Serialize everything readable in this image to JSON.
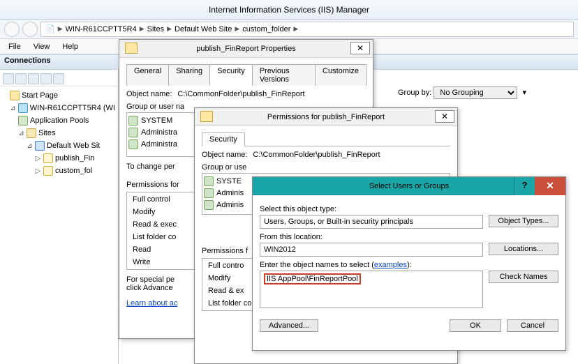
{
  "window": {
    "title": "Internet Information Services (IIS) Manager"
  },
  "breadcrumb": [
    "WIN-R61CCPTT5R4",
    "Sites",
    "Default Web Site",
    "custom_folder"
  ],
  "menu": {
    "file": "File",
    "view": "View",
    "help": "Help"
  },
  "connections": {
    "header": "Connections"
  },
  "tree": {
    "start": "Start Page",
    "server": "WIN-R61CCPTT5R4 (WI",
    "pools": "Application Pools",
    "sites": "Sites",
    "defaultSite": "Default Web Sit",
    "pub": "publish_Fin",
    "custom": "custom_fol"
  },
  "groupby": {
    "label": "Group by:",
    "value": "No Grouping"
  },
  "props": {
    "title": "publish_FinReport Properties",
    "tabs": {
      "general": "General",
      "sharing": "Sharing",
      "security": "Security",
      "prev": "Previous Versions",
      "custom": "Customize"
    },
    "objNameLabel": "Object name:",
    "objName": "C:\\CommonFolder\\publish_FinReport",
    "groupLabel": "Group or user na",
    "system": "SYSTEM",
    "admin1": "Administra",
    "admin2": "Administra",
    "changeLine": "To change per",
    "permFor": "Permissions for",
    "fullControl": "Full control",
    "modify": "Modify",
    "readExec": "Read & exec",
    "listFolder": "List folder co",
    "read": "Read",
    "write": "Write",
    "special": "For special pe",
    "advancedClick": "click Advance",
    "learn": "Learn about ac"
  },
  "perm": {
    "title": "Permissions for publish_FinReport",
    "tab": "Security",
    "objNameLabel": "Object name:",
    "objName": "C:\\CommonFolder\\publish_FinReport",
    "groupLabel": "Group or use",
    "system": "SYSTE",
    "admin1": "Adminis",
    "admin2": "Adminis",
    "permFor": "Permissions f",
    "fullControl": "Full contro",
    "modify": "Modify",
    "readExec": "Read & ex",
    "listFolder": "List folder contents"
  },
  "select": {
    "title": "Select Users or Groups",
    "objTypeLabel": "Select this object type:",
    "objType": "Users, Groups, or Built-in security principals",
    "objTypesBtn": "Object Types...",
    "locLabel": "From this location:",
    "loc": "WIN2012",
    "locBtn": "Locations...",
    "namesLabel1": "Enter the object names to select ",
    "examples": "examples",
    "namesLabel2": "):",
    "input": "IIS AppPool\\FinReportPool",
    "checkBtn": "Check Names",
    "advanced": "Advanced...",
    "ok": "OK",
    "cancel": "Cancel"
  }
}
